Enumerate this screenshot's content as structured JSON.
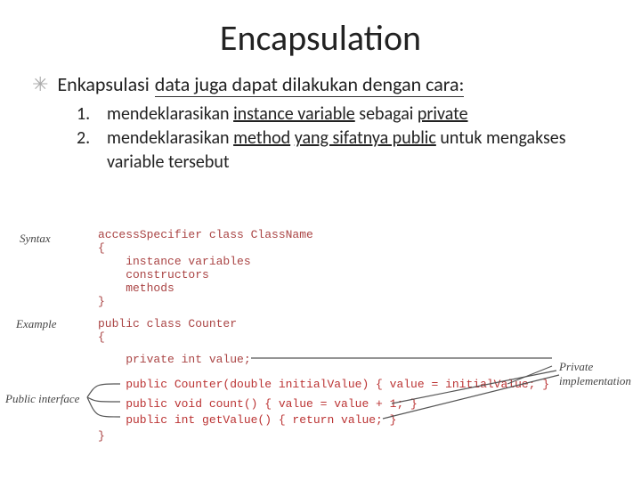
{
  "title": "Encapsulation",
  "bullet": {
    "intro_prefix": "Enkapsulasi",
    "intro_underlined": "data juga dapat dilakukan dengan cara:",
    "items": [
      {
        "num": "1.",
        "text_pre": "mendeklarasikan ",
        "u1": "instance variable",
        "mid": " sebagai ",
        "u2": "private",
        "post": ""
      },
      {
        "num": "2.",
        "text_pre": "mendeklarasikan ",
        "u1": "method",
        "mid": " ",
        "u2": "yang sifatnya public",
        "post": " untuk mengakses variable tersebut"
      }
    ]
  },
  "diagram": {
    "label_syntax": "Syntax",
    "label_example": "Example",
    "label_public_interface": "Public interface",
    "label_private_impl": "Private implementation",
    "syntax_block": "accessSpecifier class ClassName\n{\n    instance variables\n    constructors\n    methods\n}",
    "example_head": "public class Counter\n{",
    "priv_line": "    private int value;",
    "pub_line1": "    public Counter(double initialValue) { value = initialValue; }",
    "pub_line2": "    public void count() { value = value + 1; }",
    "pub_line3": "    public int getValue() { return value; }",
    "example_close": "}"
  }
}
